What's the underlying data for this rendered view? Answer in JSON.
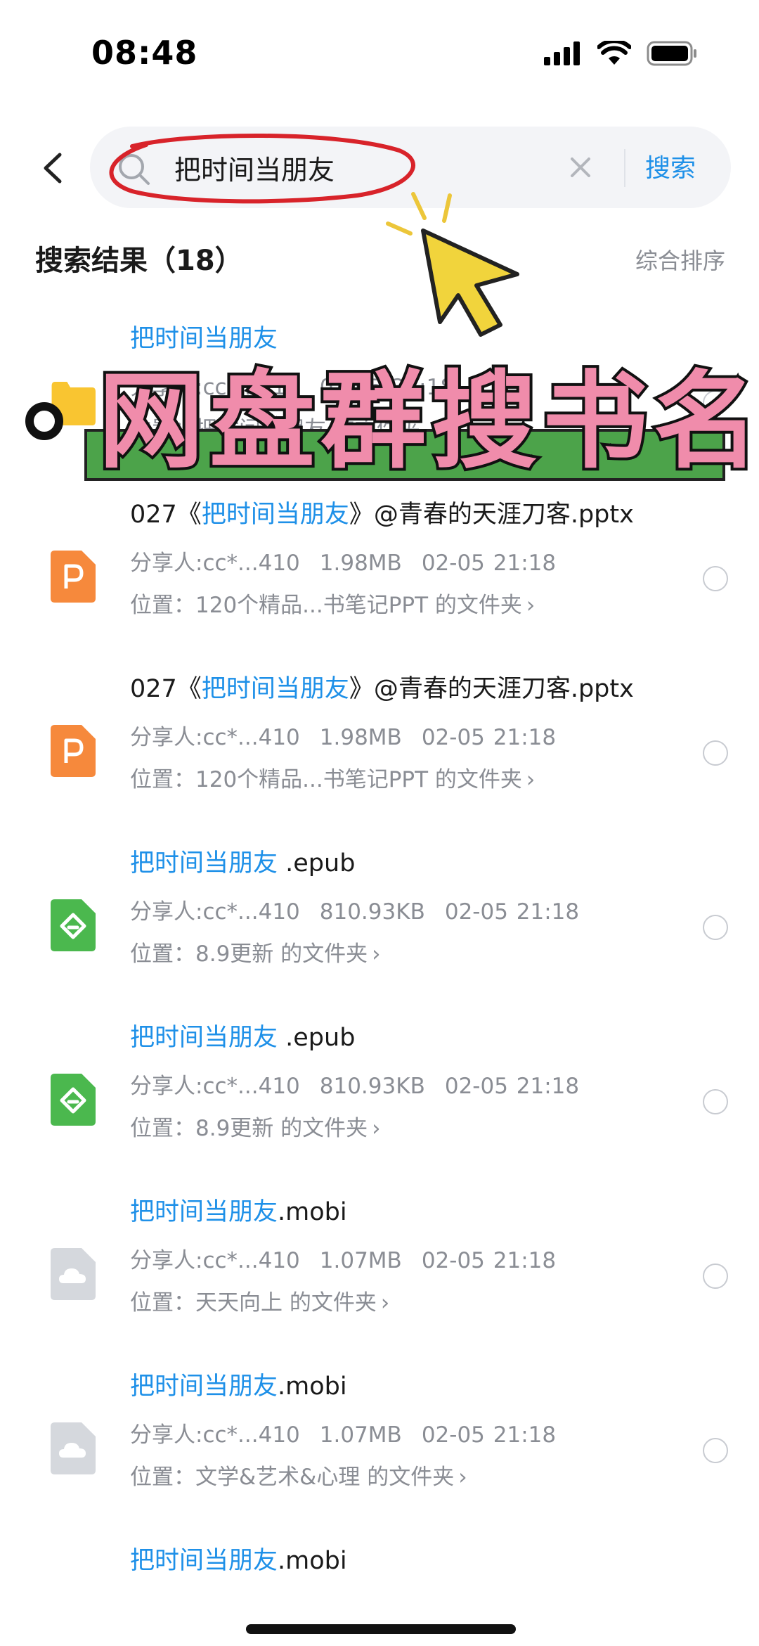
{
  "status_bar": {
    "time": "08:48"
  },
  "search": {
    "query": "把时间当朋友",
    "submit_label": "搜索"
  },
  "results": {
    "title": "搜索结果（18）",
    "sort_label": "综合排序",
    "items": [
      {
        "type": "folder",
        "name_hl": "把时间当朋友",
        "name_rest": "",
        "sharer": "分享人:cc*...410",
        "size": "",
        "date": "02-05 21:18",
        "path": "位置：把时间当朋友 的文件夹"
      },
      {
        "type": "pptx",
        "name_pre": "027《",
        "name_hl": "把时间当朋友",
        "name_rest": "》@青春的天涯刀客.pptx",
        "sharer": "分享人:cc*...410",
        "size": "1.98MB",
        "date": "02-05 21:18",
        "path": "位置：120个精品...书笔记PPT 的文件夹"
      },
      {
        "type": "pptx",
        "name_pre": "027《",
        "name_hl": "把时间当朋友",
        "name_rest": "》@青春的天涯刀客.pptx",
        "sharer": "分享人:cc*...410",
        "size": "1.98MB",
        "date": "02-05 21:18",
        "path": "位置：120个精品...书笔记PPT 的文件夹"
      },
      {
        "type": "epub",
        "name_pre": "",
        "name_hl": "把时间当朋友",
        "name_rest": " .epub",
        "sharer": "分享人:cc*...410",
        "size": "810.93KB",
        "date": "02-05 21:18",
        "path": "位置：8.9更新 的文件夹"
      },
      {
        "type": "epub",
        "name_pre": "",
        "name_hl": "把时间当朋友",
        "name_rest": " .epub",
        "sharer": "分享人:cc*...410",
        "size": "810.93KB",
        "date": "02-05 21:18",
        "path": "位置：8.9更新 的文件夹"
      },
      {
        "type": "mobi",
        "name_pre": "",
        "name_hl": "把时间当朋友",
        "name_rest": ".mobi",
        "sharer": "分享人:cc*...410",
        "size": "1.07MB",
        "date": "02-05 21:18",
        "path": "位置：天天向上 的文件夹"
      },
      {
        "type": "mobi",
        "name_pre": "",
        "name_hl": "把时间当朋友",
        "name_rest": ".mobi",
        "sharer": "分享人:cc*...410",
        "size": "1.07MB",
        "date": "02-05 21:18",
        "path": "位置：文学&艺术&心理 的文件夹"
      },
      {
        "type": "mobi",
        "name_pre": "",
        "name_hl": "把时间当朋友",
        "name_rest": ".mobi",
        "sharer": "",
        "size": "",
        "date": "",
        "path": ""
      }
    ]
  },
  "overlay": {
    "banner_text": "网盘群搜书名"
  },
  "colors": {
    "accent": "#1e90e8",
    "banner_green": "#4ca34a",
    "banner_pink": "#f08cab",
    "ppt_orange": "#f6893c",
    "epub_green": "#4bb84e",
    "folder_yellow": "#f9c531",
    "cloud_gray": "#d5d8dd"
  }
}
